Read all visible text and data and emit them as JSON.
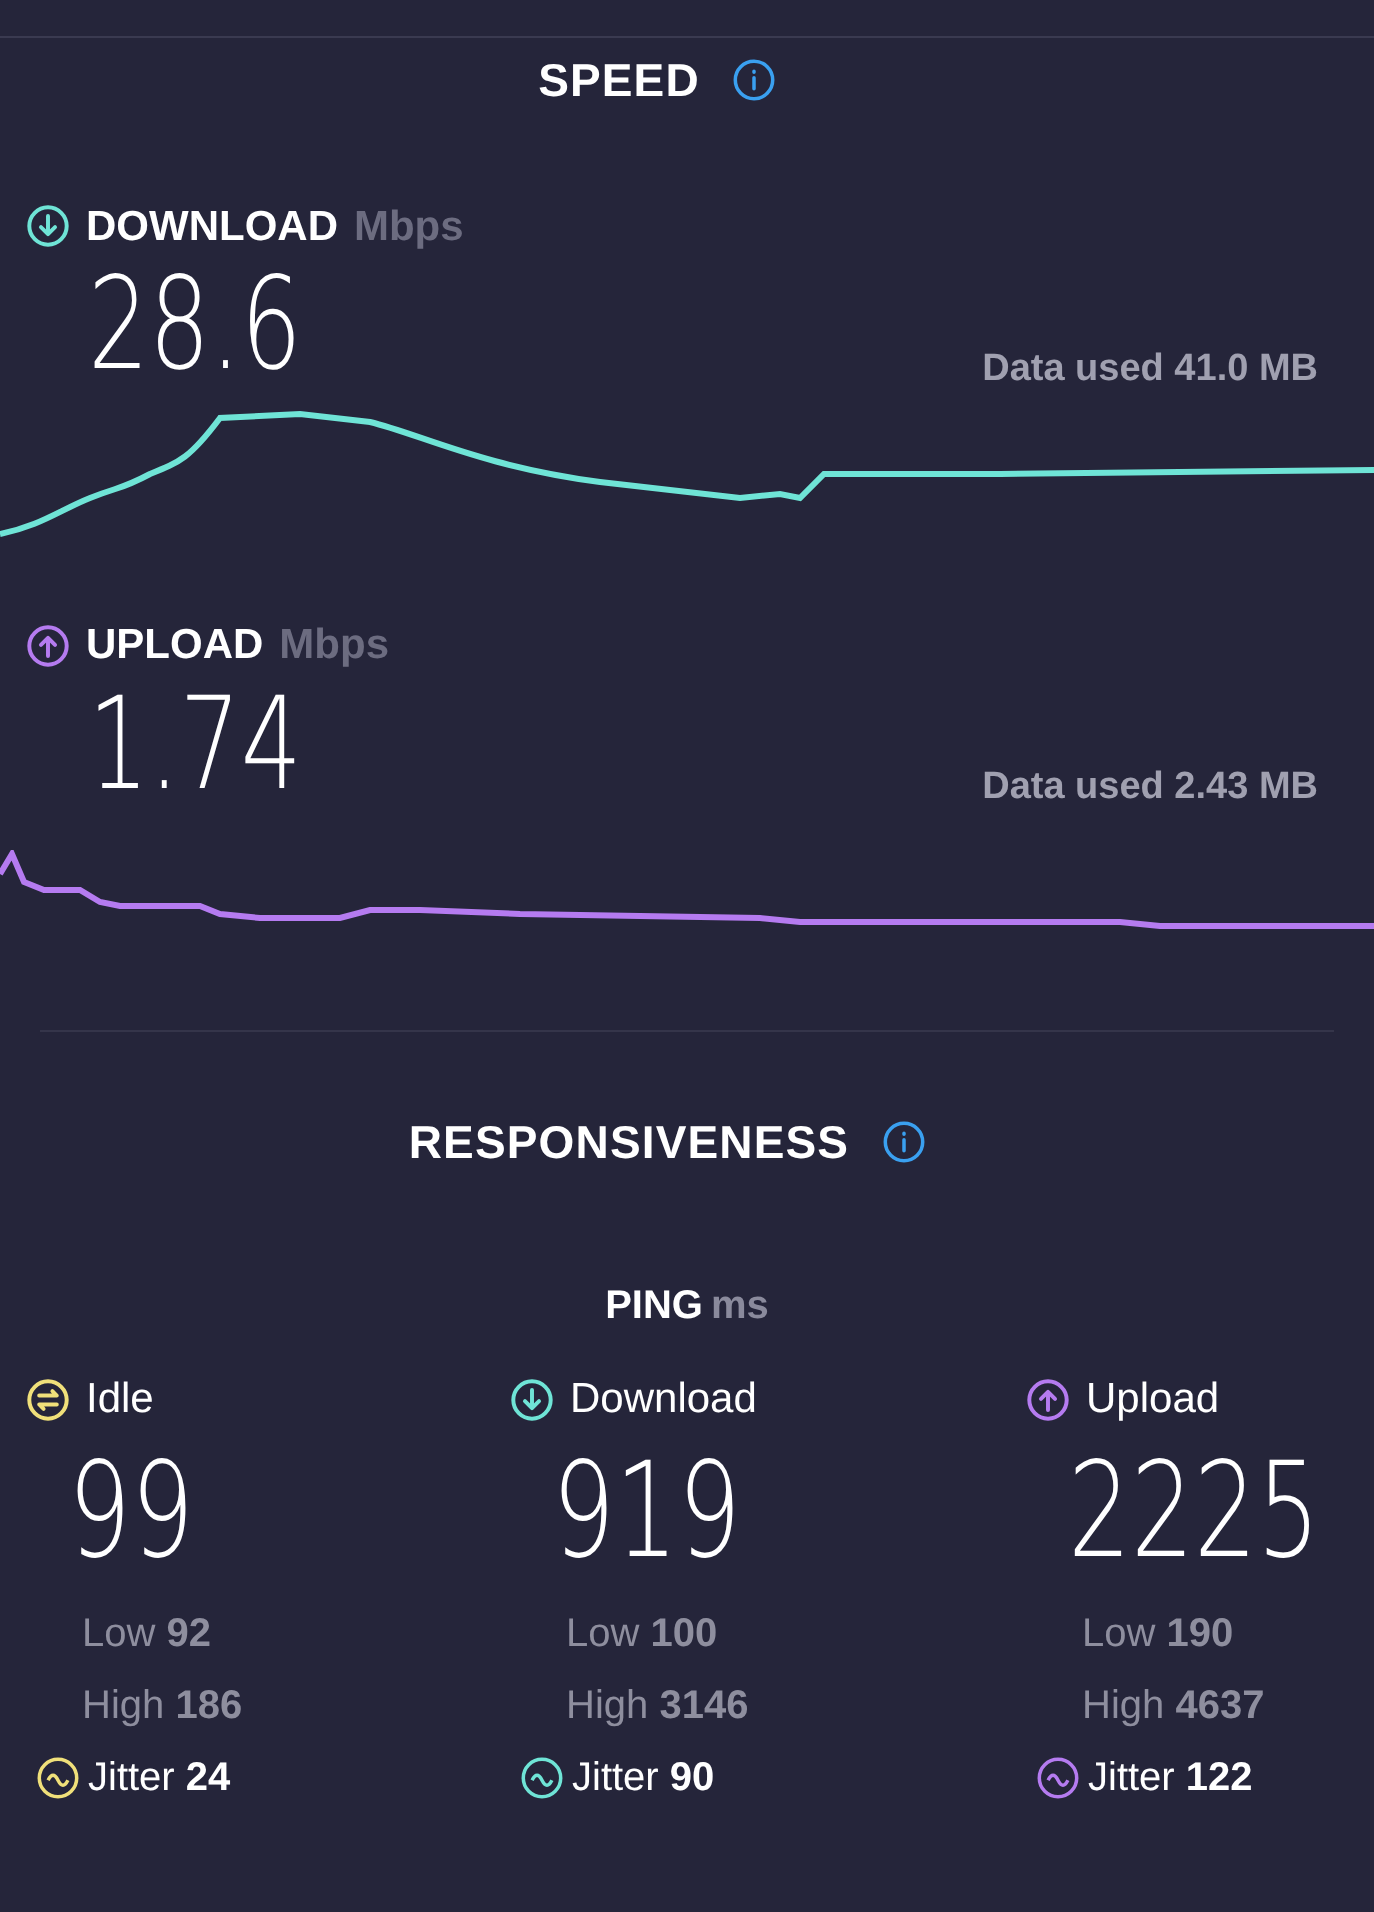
{
  "speed": {
    "title": "SPEED",
    "tests": [
      {
        "kind": "download",
        "label": "DOWNLOAD",
        "unit": "Mbps",
        "value": "28.6",
        "data_used": "Data used 41.0 MB"
      },
      {
        "kind": "upload",
        "label": "UPLOAD",
        "unit": "Mbps",
        "value": "1.74",
        "data_used": "Data used 2.43 MB"
      }
    ]
  },
  "responsiveness": {
    "title": "RESPONSIVENESS",
    "ping_label": "PING",
    "ping_unit": "ms",
    "columns": [
      {
        "kind": "idle",
        "label": "Idle",
        "value": "99",
        "low": {
          "label": "Low",
          "value": "92"
        },
        "high": {
          "label": "High",
          "value": "186"
        },
        "jitter": {
          "label": "Jitter",
          "value": "24"
        }
      },
      {
        "kind": "download",
        "label": "Download",
        "value": "919",
        "low": {
          "label": "Low",
          "value": "100"
        },
        "high": {
          "label": "High",
          "value": "3146"
        },
        "jitter": {
          "label": "Jitter",
          "value": "90"
        }
      },
      {
        "kind": "upload",
        "label": "Upload",
        "value": "2225",
        "low": {
          "label": "Low",
          "value": "190"
        },
        "high": {
          "label": "High",
          "value": "4637"
        },
        "jitter": {
          "label": "Jitter",
          "value": "122"
        }
      }
    ]
  }
}
